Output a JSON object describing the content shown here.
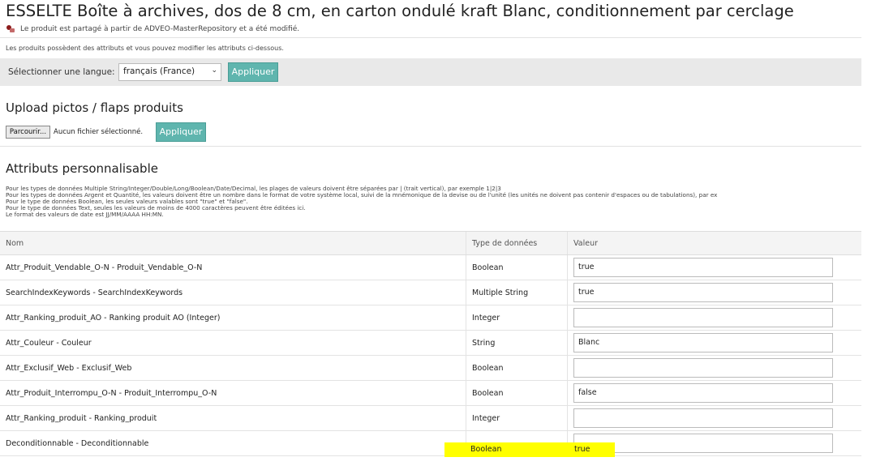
{
  "product": {
    "title": "ESSELTE Boîte à archives, dos de 8 cm, en carton ondulé kraft Blanc, conditionnement par cerclage",
    "shared_notice": "Le produit est partagé à partir de ADVEO-MasterRepository et a été modifié.",
    "attributes_notice": "Les produits possèdent des attributs et vous pouvez modifier les attributs ci-dessous."
  },
  "language": {
    "label": "Sélectionner une langue:",
    "selected": "français (France)",
    "apply_label": "Appliquer"
  },
  "upload": {
    "heading": "Upload pictos / flaps produits",
    "browse_label": "Parcourir...",
    "file_status": "Aucun fichier sélectionné.",
    "apply_label": "Appliquer"
  },
  "custom_attributes": {
    "heading": "Attributs personnalisable",
    "instructions": [
      "Pour les types de données Multiple String/Integer/Double/Long/Boolean/Date/Decimal, les plages de valeurs doivent être séparées par | (trait vertical), par exemple 1|2|3",
      "Pour les types de données Argent et Quantité, les valeurs doivent être un nombre dans le format de votre système local, suivi de la mnémonique de la devise ou de l'unité (les unités ne doivent pas contenir d'espaces ou de tabulations), par ex",
      "Pour le type de données Boolean, les seules valeurs valables sont \"true\" et \"false\".",
      "Pour le type de données Text, seules les valeurs de moins de 4000 caractères peuvent être éditées ici.",
      "Le format des valeurs de date est JJ/MM/AAAA HH:MN."
    ],
    "columns": {
      "name": "Nom",
      "type": "Type de données",
      "value": "Valeur"
    },
    "rows": [
      {
        "name": "Attr_Produit_Vendable_O-N - Produit_Vendable_O-N",
        "type": "Boolean",
        "value": "true"
      },
      {
        "name": "SearchIndexKeywords - SearchIndexKeywords",
        "type": "Multiple String",
        "value": "true"
      },
      {
        "name": "Attr_Ranking_produit_AO - Ranking produit AO (Integer)",
        "type": "Integer",
        "value": ""
      },
      {
        "name": "Attr_Couleur - Couleur",
        "type": "String",
        "value": "Blanc"
      },
      {
        "name": "Attr_Exclusif_Web - Exclusif_Web",
        "type": "Boolean",
        "value": ""
      },
      {
        "name": "Attr_Produit_Interrompu_O-N - Produit_Interrompu_O-N",
        "type": "Boolean",
        "value": "false"
      },
      {
        "name": "Attr_Ranking_produit - Ranking_produit",
        "type": "Integer",
        "value": ""
      },
      {
        "name": "Deconditionnable - Deconditionnable",
        "type": "Boolean",
        "value": "true"
      }
    ]
  },
  "colors": {
    "apply_button": "#5fb5ae",
    "highlight": "#ffff00"
  }
}
